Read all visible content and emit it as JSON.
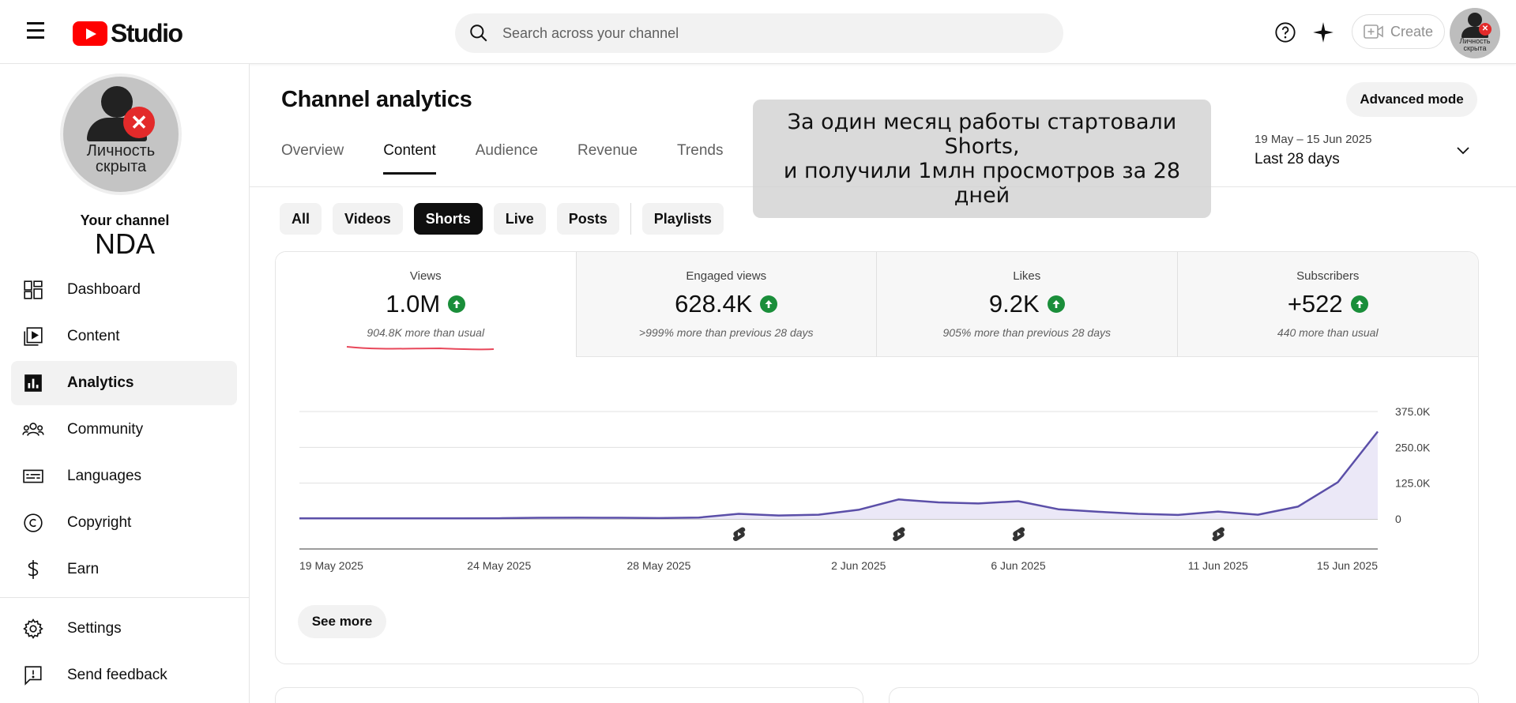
{
  "header": {
    "logo_text": "Studio",
    "search_placeholder": "Search across your channel",
    "create_label": "Create"
  },
  "avatar": {
    "caption_line1": "Личность",
    "caption_line2": "скрыта",
    "badge": "✕"
  },
  "sidebar": {
    "your_channel_label": "Your channel",
    "channel_name": "NDA",
    "items": [
      {
        "label": "Dashboard",
        "icon": "dashboard-icon"
      },
      {
        "label": "Content",
        "icon": "content-icon"
      },
      {
        "label": "Analytics",
        "icon": "analytics-icon",
        "active": true
      },
      {
        "label": "Community",
        "icon": "community-icon"
      },
      {
        "label": "Languages",
        "icon": "languages-icon"
      },
      {
        "label": "Copyright",
        "icon": "copyright-icon"
      },
      {
        "label": "Earn",
        "icon": "earn-icon"
      },
      {
        "label": "Settings",
        "icon": "settings-icon"
      },
      {
        "label": "Send feedback",
        "icon": "feedback-icon"
      }
    ]
  },
  "main": {
    "title": "Channel analytics",
    "advanced_mode_label": "Advanced mode",
    "tabs": [
      "Overview",
      "Content",
      "Audience",
      "Revenue",
      "Trends"
    ],
    "active_tab": "Content",
    "date_range": {
      "range": "19 May – 15 Jun 2025",
      "label": "Last 28 days"
    },
    "annotation": "За один месяц работы стартовали Shorts,\nи получили 1млн просмотров за 28 дней",
    "chips": [
      "All",
      "Videos",
      "Shorts",
      "Live",
      "Posts",
      "Playlists"
    ],
    "active_chip": "Shorts",
    "metrics": [
      {
        "label": "Views",
        "value": "1.0M",
        "sub": "904.8K more than usual"
      },
      {
        "label": "Engaged views",
        "value": "628.4K",
        "sub": ">999% more than previous 28 days"
      },
      {
        "label": "Likes",
        "value": "9.2K",
        "sub": "905% more than previous 28 days"
      },
      {
        "label": "Subscribers",
        "value": "+522",
        "sub": "440 more than usual"
      }
    ],
    "see_more_label": "See more"
  },
  "colors": {
    "brand_red": "#ff0000",
    "chart_line": "#5b4fa8",
    "chart_fill": "#ebe8f7",
    "up_green": "#1a8e3a"
  },
  "chart_data": {
    "type": "area",
    "x": [
      "19 May",
      "20 May",
      "21 May",
      "22 May",
      "23 May",
      "24 May",
      "25 May",
      "26 May",
      "27 May",
      "28 May",
      "29 May",
      "30 May",
      "31 May",
      "1 Jun",
      "2 Jun",
      "3 Jun",
      "4 Jun",
      "5 Jun",
      "6 Jun",
      "7 Jun",
      "8 Jun",
      "9 Jun",
      "10 Jun",
      "11 Jun",
      "12 Jun",
      "13 Jun",
      "14 Jun",
      "15 Jun"
    ],
    "values": [
      2000,
      2000,
      2000,
      2000,
      2000,
      2500,
      4000,
      4500,
      4000,
      3000,
      5000,
      18000,
      12000,
      15000,
      32000,
      68000,
      58000,
      54000,
      62000,
      34000,
      25000,
      18000,
      14000,
      26000,
      15000,
      43000,
      128000,
      305000
    ],
    "x_tick_labels": [
      "19 May 2025",
      "24 May 2025",
      "28 May 2025",
      "2 Jun 2025",
      "6 Jun 2025",
      "11 Jun 2025",
      "15 Jun 2025"
    ],
    "x_tick_index": [
      0,
      5,
      9,
      14,
      18,
      23,
      27
    ],
    "y_ticks": [
      0,
      125000,
      250000,
      375000
    ],
    "y_tick_labels": [
      "0",
      "125.0K",
      "250.0K",
      "375.0K"
    ],
    "ylim": [
      0,
      375000
    ],
    "shorts_markers": [
      11,
      15,
      18,
      23
    ],
    "grid": true,
    "xlabel": "",
    "ylabel": ""
  }
}
